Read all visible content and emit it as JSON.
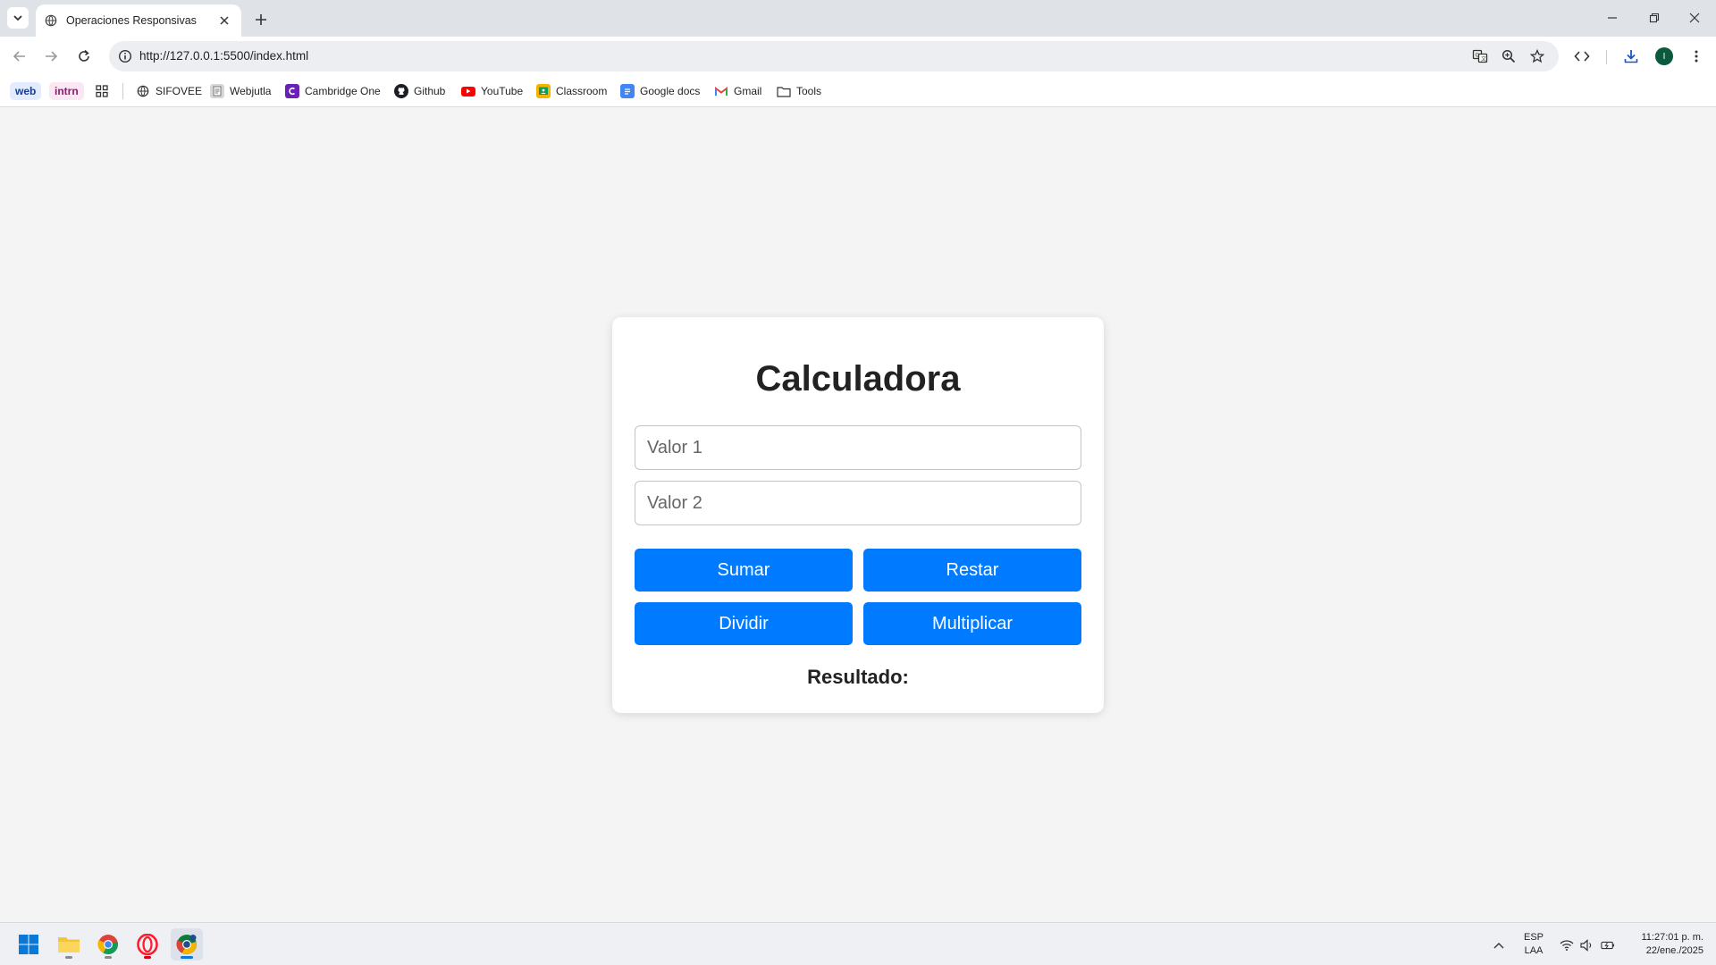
{
  "browser": {
    "tab_title": "Operaciones Responsivas",
    "url": "http://127.0.0.1:5500/index.html",
    "avatar_letter": "I",
    "bookmarks": [
      {
        "label": "web",
        "kind": "chip",
        "color": "#1a3d8f",
        "bg": "#e3ecff"
      },
      {
        "label": "intrn",
        "kind": "chip",
        "color": "#8a1e6e",
        "bg": "#fbe6f4"
      },
      {
        "label": "SIFOVEE",
        "icon": "globe-icon"
      },
      {
        "label": "Webjutla",
        "icon": "document-icon"
      },
      {
        "label": "Cambridge One",
        "icon": "cambridge-icon"
      },
      {
        "label": "Github",
        "icon": "github-icon"
      },
      {
        "label": "YouTube",
        "icon": "youtube-icon"
      },
      {
        "label": "Classroom",
        "icon": "classroom-icon"
      },
      {
        "label": "Google docs",
        "icon": "docs-icon"
      },
      {
        "label": "Gmail",
        "icon": "gmail-icon"
      },
      {
        "label": "Tools",
        "icon": "folder-icon"
      }
    ]
  },
  "page": {
    "title": "Calculadora",
    "input1_placeholder": "Valor 1",
    "input1_value": "",
    "input2_placeholder": "Valor 2",
    "input2_value": "",
    "buttons": {
      "sumar": "Sumar",
      "restar": "Restar",
      "dividir": "Dividir",
      "multiplicar": "Multiplicar"
    },
    "result_label": "Resultado:",
    "accent_color": "#007bff"
  },
  "taskbar": {
    "language_line1": "ESP",
    "language_line2": "LAA",
    "time": "11:27:01 p. m.",
    "date": "22/ene./2025"
  }
}
